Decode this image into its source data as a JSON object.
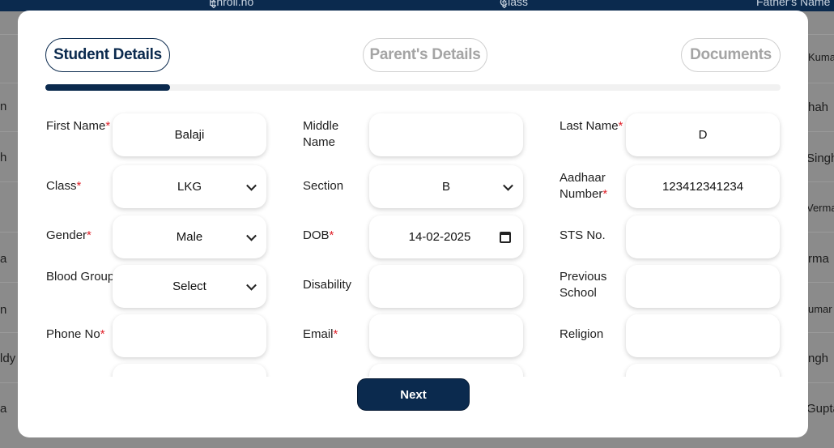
{
  "background_table": {
    "headers": [
      "Enroll.no",
      "Class",
      "Father's Name"
    ],
    "sort_icon": "sort-icon",
    "left_fragments": [
      "n",
      "h",
      "",
      "a",
      "n",
      "ldy",
      "a"
    ],
    "right_fragments": [
      "Kuma",
      "hah",
      "Singh",
      "Verma",
      "rma",
      "umar",
      "ngh",
      "Gupta"
    ]
  },
  "tabs": [
    {
      "label": "Student Details",
      "active": true
    },
    {
      "label": "Parent's Details",
      "active": false
    },
    {
      "label": "Documents",
      "active": false
    }
  ],
  "progress": {
    "fraction": 0.17
  },
  "form": {
    "rows": [
      [
        {
          "label": "First Name",
          "required": true,
          "type": "text",
          "value": ""
        },
        {
          "label": "Middle Name",
          "required": false,
          "type": "text",
          "value": ""
        },
        {
          "label": "Last Name",
          "required": true,
          "type": "text",
          "value": "D"
        }
      ],
      [
        {
          "label": "Class",
          "required": true,
          "type": "select",
          "value": "LKG"
        },
        {
          "label": "Section",
          "required": false,
          "type": "select",
          "value": "B"
        },
        {
          "label": "Aadhaar Number",
          "required": true,
          "type": "text",
          "value": "123412341234"
        }
      ],
      [
        {
          "label": "Gender",
          "required": true,
          "type": "select",
          "value": "Male"
        },
        {
          "label": "DOB",
          "required": true,
          "type": "date",
          "value": "14-02-2025"
        },
        {
          "label": "STS No.",
          "required": false,
          "type": "text",
          "value": ""
        }
      ],
      [
        {
          "label": "Blood Group",
          "required": false,
          "type": "select",
          "value": "Select"
        },
        {
          "label": "Disability",
          "required": false,
          "type": "text",
          "value": ""
        },
        {
          "label": "Previous School",
          "required": false,
          "type": "text",
          "value": ""
        }
      ],
      [
        {
          "label": "Phone No",
          "required": true,
          "type": "text",
          "value": ""
        },
        {
          "label": "Email",
          "required": true,
          "type": "text",
          "value": ""
        },
        {
          "label": "Religion",
          "required": false,
          "type": "text",
          "value": ""
        }
      ]
    ],
    "first_name_value": "Balaji"
  },
  "next_button": {
    "label": "Next"
  },
  "colors": {
    "primary": "#0b2a4e",
    "required": "#e0222b",
    "inactive": "#a4a4a4"
  }
}
